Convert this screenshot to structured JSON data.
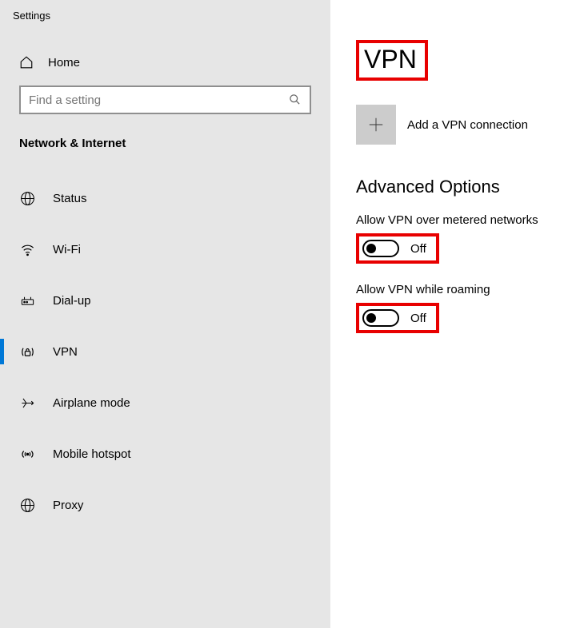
{
  "app_title": "Settings",
  "home_label": "Home",
  "search": {
    "placeholder": "Find a setting"
  },
  "section_header": "Network & Internet",
  "nav": {
    "status": "Status",
    "wifi": "Wi-Fi",
    "dialup": "Dial-up",
    "vpn": "VPN",
    "airplane": "Airplane mode",
    "hotspot": "Mobile hotspot",
    "proxy": "Proxy"
  },
  "page_title": "VPN",
  "add_vpn_label": "Add a VPN connection",
  "advanced_header": "Advanced Options",
  "toggle1": {
    "label": "Allow VPN over metered networks",
    "state": "Off"
  },
  "toggle2": {
    "label": "Allow VPN while roaming",
    "state": "Off"
  }
}
